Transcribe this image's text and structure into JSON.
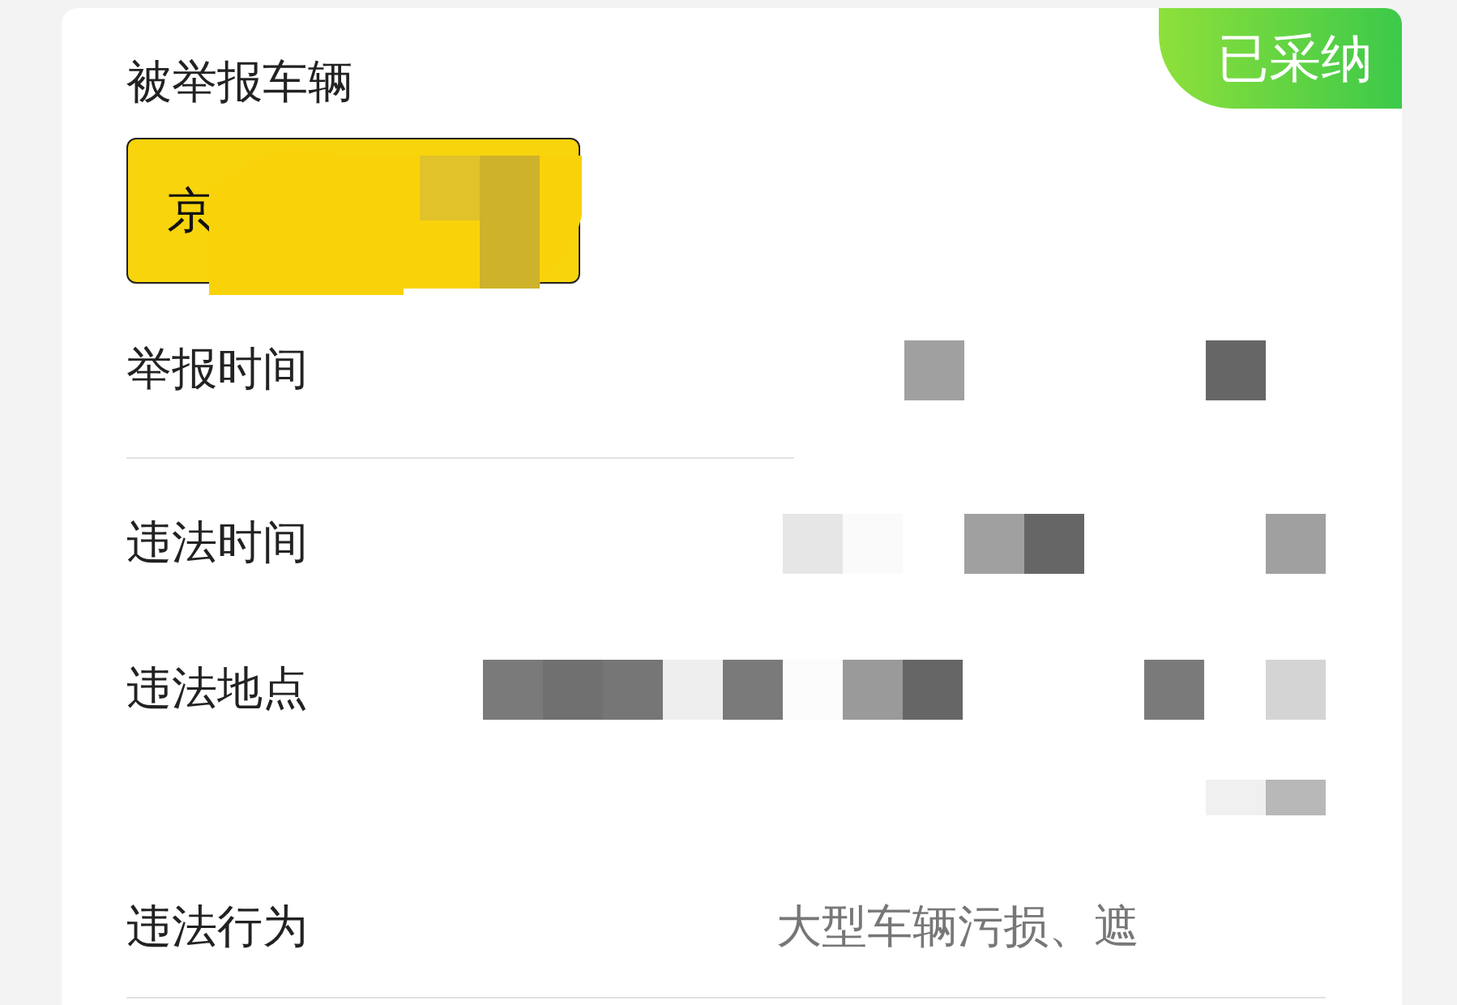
{
  "report": {
    "title": "被举报车辆",
    "status_badge": "已采纳",
    "plate": {
      "prefix": "京"
    },
    "fields": [
      {
        "label": "举报时间"
      },
      {
        "label": "违法时间"
      },
      {
        "label": "违法地点"
      },
      {
        "label": "违法行为",
        "value": "大型车辆污损、遮"
      }
    ]
  }
}
